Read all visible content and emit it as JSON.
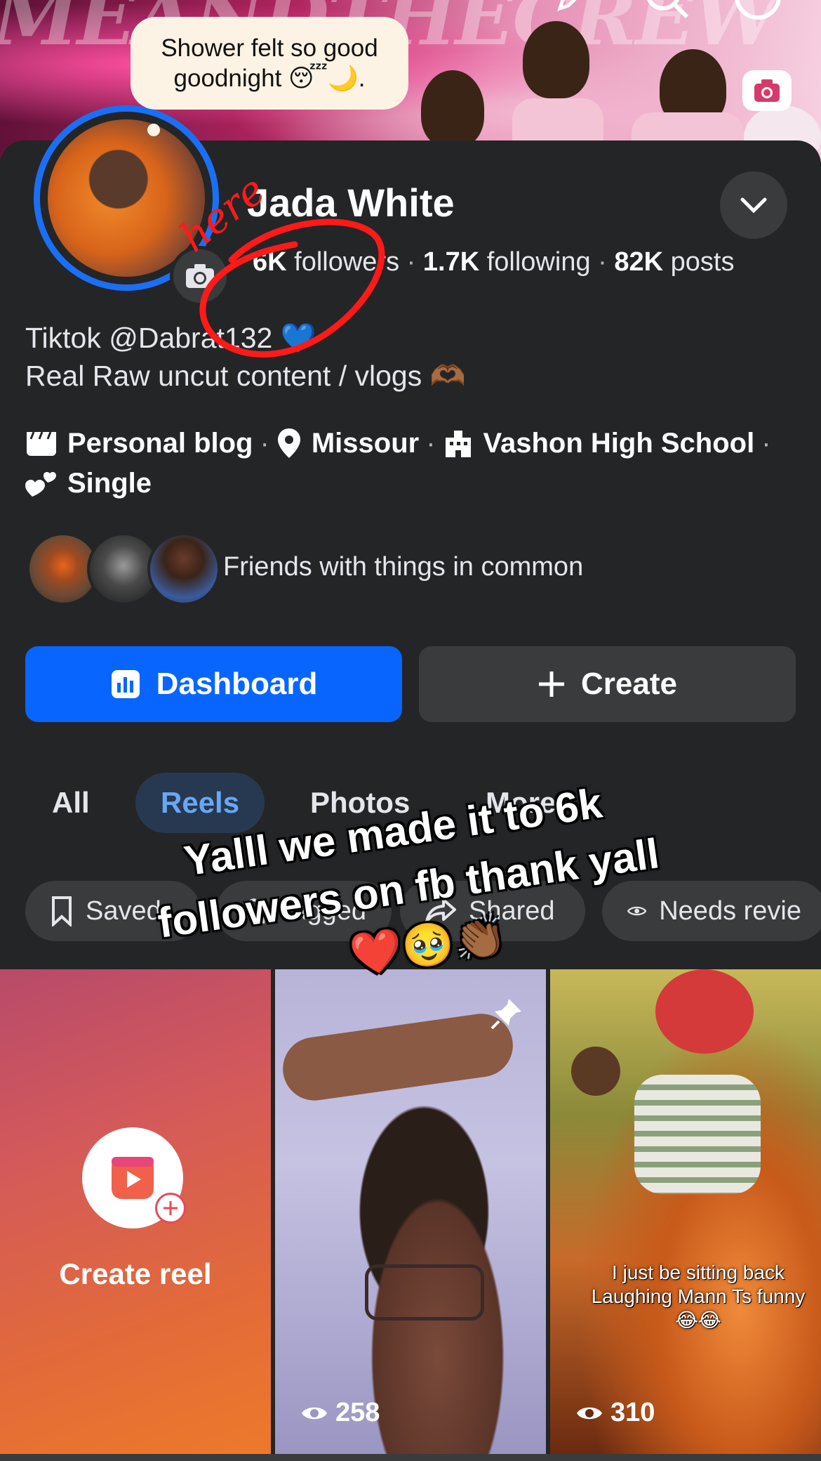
{
  "cover": {
    "title_text": "MEANDTHECREW"
  },
  "status_bubble": {
    "line1": "Shower felt so good",
    "line2": "goodnight 😴🌙."
  },
  "profile": {
    "name": "Jada White",
    "followers_count": "6K",
    "followers_label": "followers",
    "following_count": "1.7K",
    "following_label": "following",
    "posts_count": "82K",
    "posts_label": "posts",
    "bio_line1": "Tiktok @Dabrat132 💙",
    "bio_line2": "Real Raw uncut content / vlogs 🫶🏾"
  },
  "details": {
    "category": "Personal blog",
    "location": "Missour",
    "school": "Vashon High School",
    "relationship": "Single"
  },
  "friends": {
    "label": "Friends with things in common"
  },
  "buttons": {
    "dashboard": "Dashboard",
    "create": "Create"
  },
  "tabs": [
    "All",
    "Reels",
    "Photos",
    "More"
  ],
  "chips": {
    "saved": "Saved",
    "tagged": "Tagged",
    "shared": "Shared",
    "needs_review": "Needs revie"
  },
  "annotation": {
    "handwritten": "here"
  },
  "overlay": {
    "line1": "Yalll we made it to 6k",
    "line2": "followers on fb thank yall",
    "line3": "❤️🥹👏🏾"
  },
  "reels": {
    "create_label": "Create reel",
    "reel1_views": "258",
    "reel2_views": "310",
    "reel2_caption_line1": "I just be sitting back",
    "reel2_caption_line2": "Laughing Mann Ts funny",
    "reel2_caption_line3": "😂😂"
  },
  "colors": {
    "accent_blue": "#1b6ff5",
    "background": "#242527",
    "surface": "#3a3b3c",
    "annotation_red": "#ff1a1a"
  }
}
